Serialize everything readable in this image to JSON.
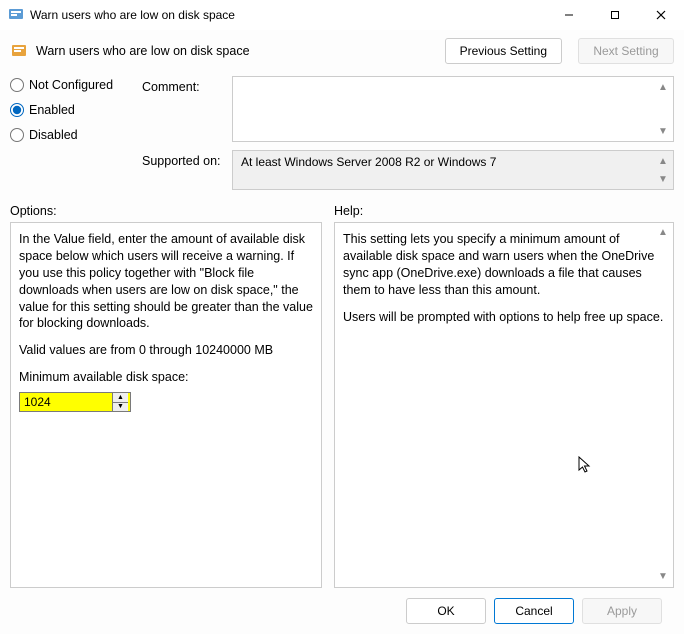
{
  "window": {
    "title": "Warn users who are low on disk space"
  },
  "header": {
    "policy_name": "Warn users who are low on disk space",
    "prev_btn": "Previous Setting",
    "next_btn": "Next Setting",
    "next_disabled": true
  },
  "state": {
    "options": [
      {
        "label": "Not Configured",
        "checked": false
      },
      {
        "label": "Enabled",
        "checked": true
      },
      {
        "label": "Disabled",
        "checked": false
      }
    ],
    "comment_label": "Comment:",
    "comment_value": "",
    "supported_label": "Supported on:",
    "supported_value": "At least Windows Server 2008 R2 or Windows 7"
  },
  "panels": {
    "options_label": "Options:",
    "help_label": "Help:",
    "options_text": "In the Value field, enter the amount of available disk space below which users will receive a warning. If you use this policy together with \"Block file downloads when users are low on disk space,\" the value for this setting should be greater than the value for blocking downloads.",
    "valid_values": "Valid values are from 0 through 10240000 MB",
    "spinner_label": "Minimum available disk space:",
    "spinner_value": "1024",
    "help_text_p1": "This setting lets you specify a minimum amount of available disk space and warn users when the OneDrive sync app (OneDrive.exe) downloads a file that causes them to have less than this amount.",
    "help_text_p2": "Users will be prompted with options to help free up space."
  },
  "footer": {
    "ok": "OK",
    "cancel": "Cancel",
    "apply": "Apply",
    "apply_disabled": true
  }
}
